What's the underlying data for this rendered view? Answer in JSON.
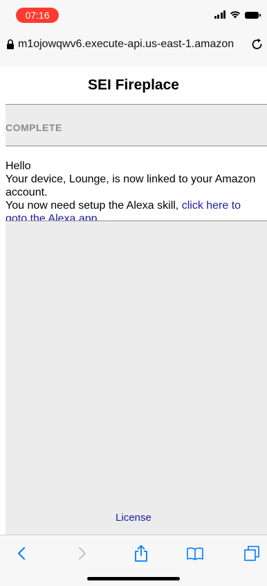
{
  "status_bar": {
    "time": "07:16",
    "time_pill_color": "#ff3b30",
    "icons": [
      "cellular-signal-icon",
      "wifi-icon",
      "battery-icon"
    ]
  },
  "browser": {
    "url": "m1ojowqwv6.execute-api.us-east-1.amazon",
    "lock_icon": "lock-icon",
    "reload_icon": "reload-icon"
  },
  "page": {
    "title": "SEI Fireplace",
    "section_label": "COMPLETE",
    "message": {
      "line1": "Hello",
      "line2": "Your device, Lounge, is now linked to your Amazon",
      "line3": "account.",
      "line4_prefix": "You now need setup the Alexa skill, ",
      "link_part1": "click here to",
      "link_part2": "goto the Alexa app"
    },
    "license_link": "License",
    "link_color": "#1a1aa6"
  },
  "toolbar": {
    "icons": [
      "back-icon",
      "forward-icon",
      "share-icon",
      "bookmarks-icon",
      "tabs-icon"
    ],
    "accent_color": "#007aff"
  }
}
